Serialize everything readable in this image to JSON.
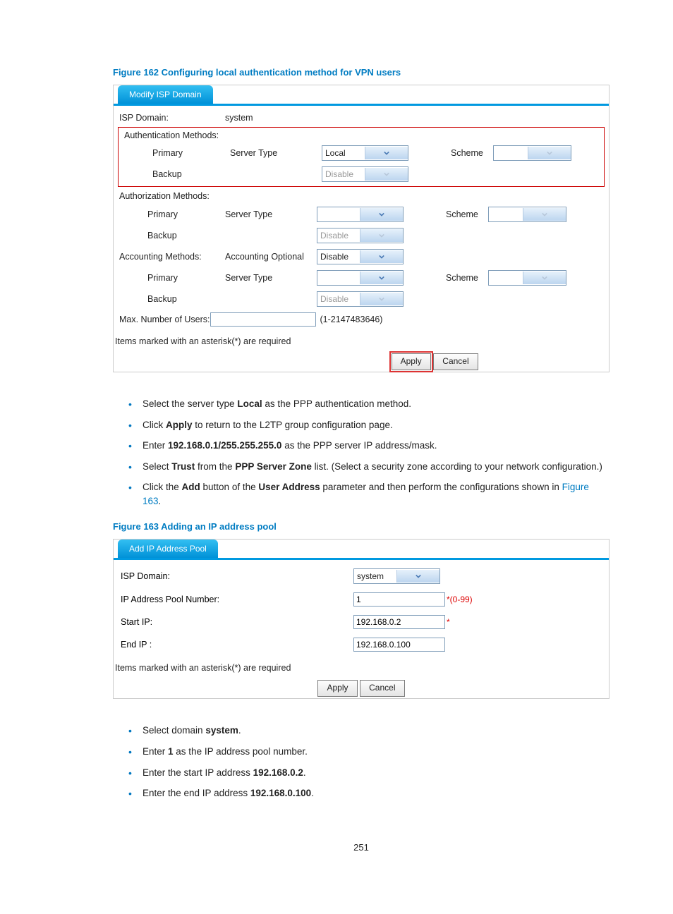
{
  "figure162": {
    "title": "Figure 162 Configuring local authentication method for VPN users",
    "tab": "Modify ISP Domain",
    "isp_domain_label": "ISP Domain:",
    "isp_domain_value": "system",
    "auth_methods_label": "Authentication Methods:",
    "primary": "Primary",
    "backup": "Backup",
    "server_type": "Server Type",
    "scheme": "Scheme",
    "auth_primary_value": "Local",
    "auth_backup_value": "Disable",
    "authz_methods_label": "Authorization Methods:",
    "authz_primary_value": "",
    "authz_backup_value": "Disable",
    "acct_methods_label": "Accounting Methods:",
    "acct_optional_label": "Accounting Optional",
    "acct_optional_value": "Disable",
    "acct_primary_value": "",
    "acct_backup_value": "Disable",
    "max_users_label": "Max. Number of Users:",
    "max_users_hint": "(1-2147483646)",
    "required_note": "Items marked with an asterisk(*) are required",
    "apply": "Apply",
    "cancel": "Cancel"
  },
  "instructions1": {
    "i1a": "Select the server type ",
    "i1b": "Local",
    "i1c": " as the PPP authentication method.",
    "i2a": "Click ",
    "i2b": "Apply",
    "i2c": " to return to the L2TP group configuration page.",
    "i3a": "Enter ",
    "i3b": "192.168.0.1/255.255.255.0",
    "i3c": " as the PPP server IP address/mask.",
    "i4a": "Select ",
    "i4b": "Trust",
    "i4c": " from the ",
    "i4d": "PPP Server Zone",
    "i4e": " list. (Select a security zone according to your network configuration.)",
    "i5a": "Click the ",
    "i5b": "Add",
    "i5c": " button of the ",
    "i5d": "User Address",
    "i5e": " parameter and then perform the configurations shown in ",
    "i5f": "Figure 163",
    "i5g": "."
  },
  "figure163": {
    "title": "Figure 163 Adding an IP address pool",
    "tab": "Add IP Address Pool",
    "isp_domain_label": "ISP Domain:",
    "isp_domain_value": "system",
    "pool_num_label": "IP Address Pool Number:",
    "pool_num_value": "1",
    "pool_num_hint": "*(0-99)",
    "start_ip_label": "Start IP:",
    "start_ip_value": "192.168.0.2",
    "end_ip_label": "End IP :",
    "end_ip_value": "192.168.0.100",
    "required_note": "Items marked with an asterisk(*) are required",
    "apply": "Apply",
    "cancel": "Cancel"
  },
  "instructions2": {
    "i1a": "Select domain ",
    "i1b": "system",
    "i1c": ".",
    "i2a": "Enter ",
    "i2b": "1",
    "i2c": " as the IP address pool number.",
    "i3a": "Enter the start IP address ",
    "i3b": "192.168.0.2",
    "i3c": ".",
    "i4a": "Enter the end IP address ",
    "i4b": "192.168.0.100",
    "i4c": "."
  },
  "page_number": "251",
  "asterisk": "*"
}
